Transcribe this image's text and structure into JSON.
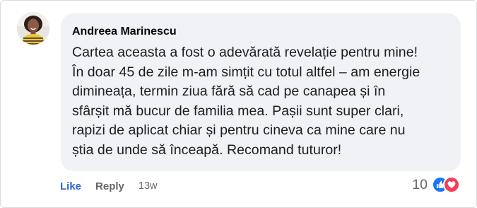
{
  "comment": {
    "author": "Andreea Marinescu",
    "text": "Cartea aceasta a fost o adevărată revelație pentru mine!\nÎn doar 45 de zile m-am simțit cu totul altfel – am energie\ndimineața, termin ziua fără să cad pe canapea și în\nsfârșit mă bucur de familia mea. Pașii sunt super clari,\nrapizi de aplicat chiar și pentru cineva ca mine care nu\nștia de unde să înceapă. Recomand tuturor!",
    "actions": {
      "like_label": "Like",
      "reply_label": "Reply",
      "timestamp": "13w"
    },
    "reactions": {
      "count": "10",
      "types": [
        "like-icon",
        "love-icon"
      ]
    }
  },
  "colors": {
    "like_blue": "#1877f2",
    "love_red": "#f33e58",
    "bubble_bg": "#f0f2f5",
    "secondary_text": "#65676b"
  }
}
